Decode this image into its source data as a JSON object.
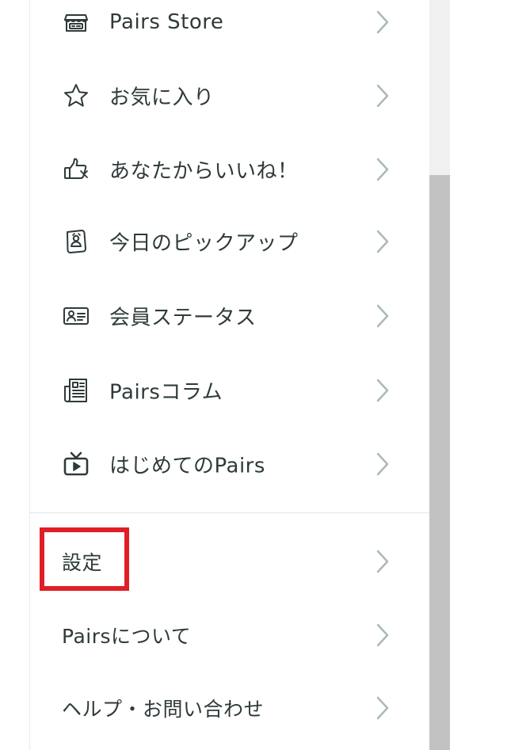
{
  "menu": {
    "items": [
      {
        "label": "Pairs Store",
        "icon": "store-icon"
      },
      {
        "label": "お気に入り",
        "icon": "star-icon"
      },
      {
        "label": "あなたからいいね！",
        "icon": "thumbs-up-icon"
      },
      {
        "label": "今日のピックアップ",
        "icon": "pickup-card-icon"
      },
      {
        "label": "会員ステータス",
        "icon": "id-card-icon"
      },
      {
        "label": "Pairsコラム",
        "icon": "column-article-icon"
      },
      {
        "label": "はじめてのPairs",
        "icon": "tv-icon"
      }
    ],
    "secondary_items": [
      {
        "label": "設定"
      },
      {
        "label": "Pairsについて"
      },
      {
        "label": "ヘルプ・お問い合わせ"
      }
    ]
  },
  "colors": {
    "text": "#2f3a3a",
    "chevron": "#a9b7b7",
    "highlight": "#e01e26",
    "scrollbar_thumb": "#c2c2c2"
  }
}
